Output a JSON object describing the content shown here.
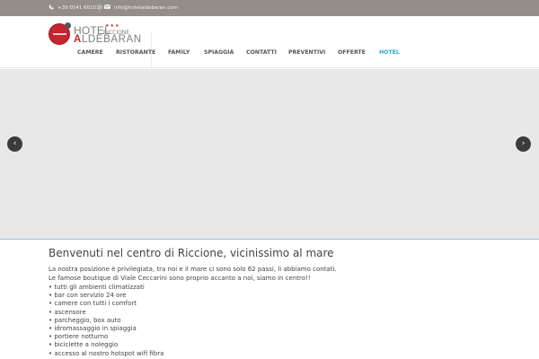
{
  "topbar": {
    "phone": "+39 0541 601510",
    "email": "info@hotelaldebaran.com"
  },
  "logo": {
    "hotel": "HOTEL",
    "city": "RICCIONE",
    "stars": "★★★",
    "name_first": "A",
    "name_rest": "LDEBARAN"
  },
  "nav": {
    "items": [
      "CAMERE",
      "RISTORANTE",
      "FAMILY",
      "SPIAGGIA",
      "CONTATTI",
      "PREVENTIVI",
      "OFFERTE",
      "HOTEL"
    ],
    "active_index": 7
  },
  "slider": {
    "prev": "‹",
    "next": "›"
  },
  "content": {
    "title": "Benvenuti nel centro di Riccione, vicinissimo al mare",
    "para1": "La nostra posizione è privilegiata, tra noi e il mare ci sono solo 62 passi, li abbiamo contati.",
    "para2": "Le famose boutique di Viale Ceccarini sono proprio accanto a noi, siamo in centro!!",
    "list": [
      "• tutti gli ambienti climatizzati",
      "• bar con servizio 24 ore",
      "• camere con tutti i comfort",
      "• ascensore",
      "• parcheggio, box auto",
      "• idromassaggio in spiaggia",
      "• portiere notturno",
      "• biciclette a noleggio",
      "• accesso al nostro hotspot wifi fibra"
    ]
  },
  "colors": {
    "topbar": "#938e88",
    "accent": "#2aa7c6",
    "brand_red": "#c7252f"
  }
}
